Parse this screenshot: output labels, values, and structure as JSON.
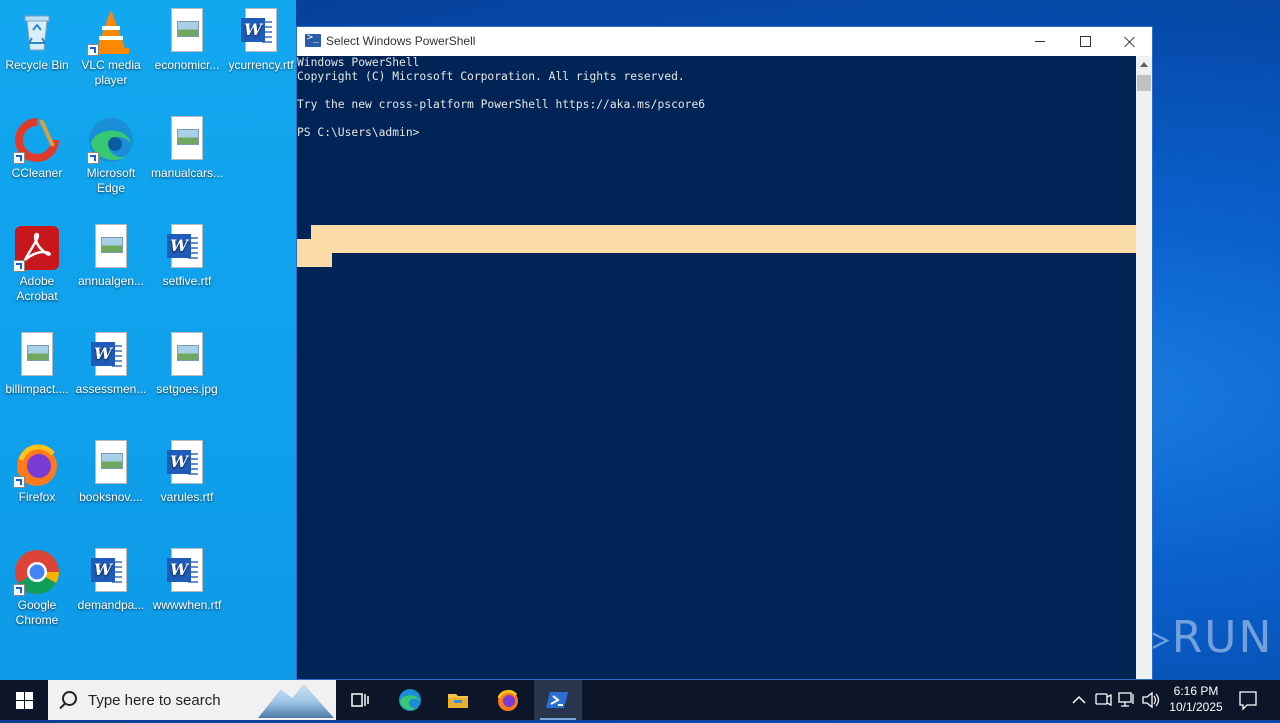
{
  "desktop": {
    "icons": [
      {
        "label": "Recycle Bin"
      },
      {
        "label": "VLC media player"
      },
      {
        "label": "economicr..."
      },
      {
        "label": "ycurrency.rtf"
      },
      {
        "label": "CCleaner"
      },
      {
        "label": "Microsoft Edge"
      },
      {
        "label": "manualcars..."
      },
      {
        "label": "Adobe Acrobat"
      },
      {
        "label": "annualgen..."
      },
      {
        "label": "setfive.rtf"
      },
      {
        "label": "billimpact...."
      },
      {
        "label": "assessmen..."
      },
      {
        "label": "setgoes.jpg"
      },
      {
        "label": "Firefox"
      },
      {
        "label": "booksnov...."
      },
      {
        "label": "varules.rtf"
      },
      {
        "label": "Google Chrome"
      },
      {
        "label": "demandpa..."
      },
      {
        "label": "wwwwhen.rtf"
      }
    ]
  },
  "window": {
    "title": "Select Windows PowerShell",
    "console_lines": [
      "Windows PowerShell",
      "Copyright (C) Microsoft Corporation. All rights reserved.",
      "",
      "Try the new cross-platform PowerShell https://aka.ms/pscore6",
      "",
      "PS C:\\Users\\admin>"
    ]
  },
  "watermark": {
    "text": "ANY▷RUN"
  },
  "taskbar": {
    "search_placeholder": "Type here to search",
    "time": "6:16 PM",
    "date": "10/1/2025"
  },
  "colors": {
    "console_bg": "#012456",
    "selection": "#fcdca6",
    "taskbar_bg": "#0d1629"
  }
}
